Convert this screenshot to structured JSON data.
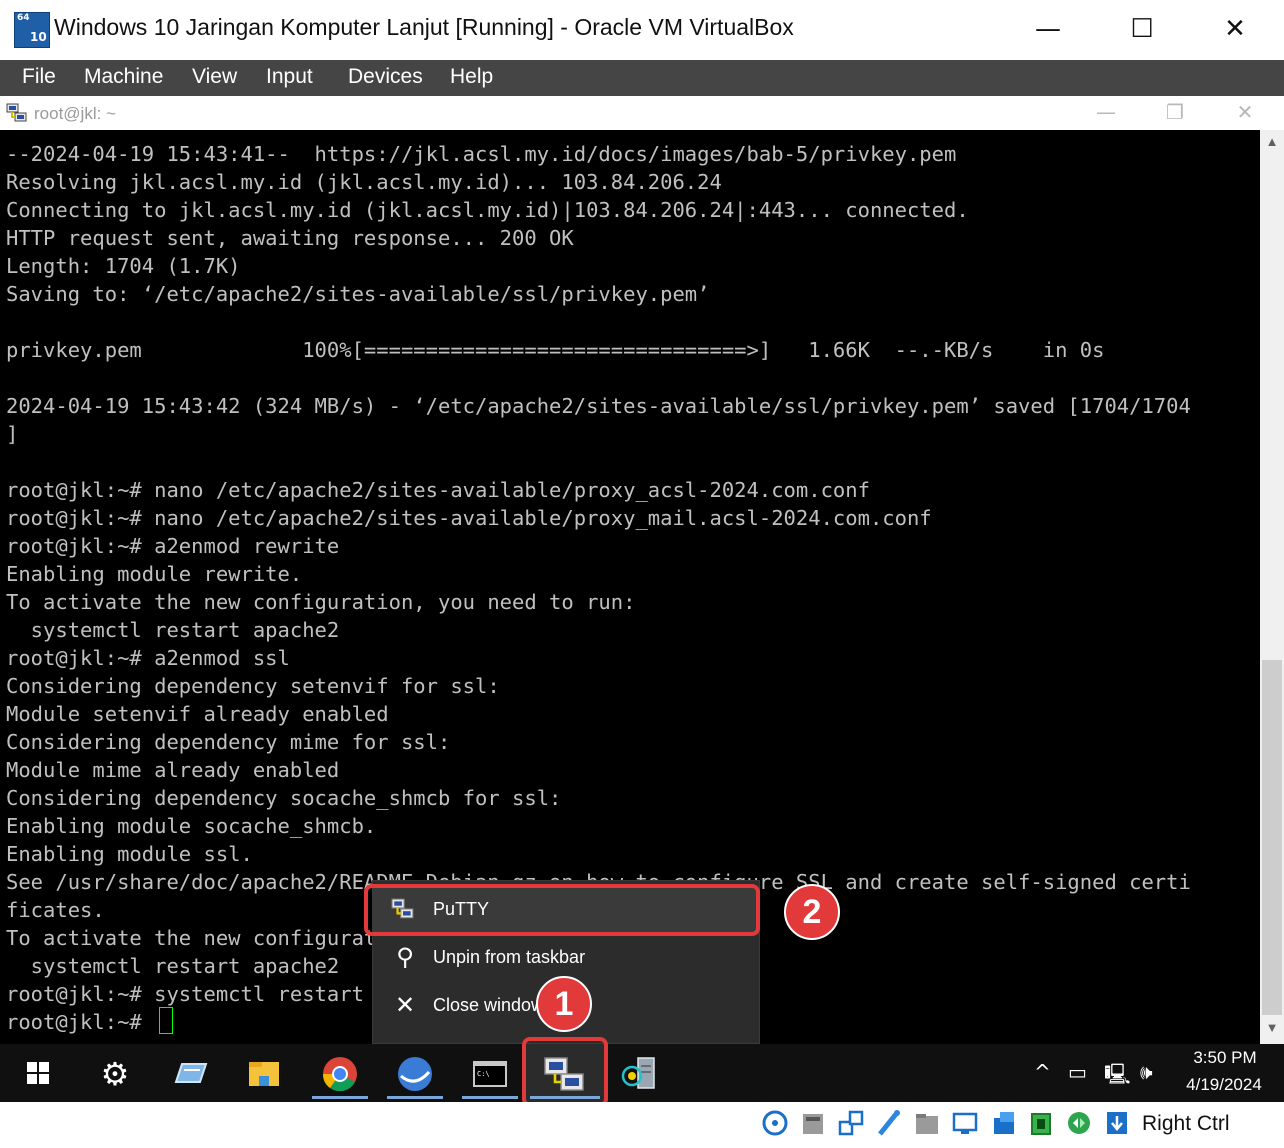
{
  "window": {
    "title": "Windows 10 Jaringan Komputer Lanjut [Running] - Oracle VM VirtualBox",
    "logo_text": "64",
    "logo_sub": "10",
    "minimize_glyph": "—",
    "maximize_glyph": "☐",
    "close_glyph": "✕"
  },
  "menubar": {
    "items": [
      {
        "label": "File"
      },
      {
        "label": "Machine"
      },
      {
        "label": "View"
      },
      {
        "label": "Input"
      },
      {
        "label": "Devices"
      },
      {
        "label": "Help"
      }
    ]
  },
  "putty": {
    "title": "root@jkl: ~",
    "minimize_glyph": "—",
    "restore_glyph": "❐",
    "close_glyph": "✕"
  },
  "terminal": {
    "text": "--2024-04-19 15:43:41--  https://jkl.acsl.my.id/docs/images/bab-5/privkey.pem\nResolving jkl.acsl.my.id (jkl.acsl.my.id)... 103.84.206.24\nConnecting to jkl.acsl.my.id (jkl.acsl.my.id)|103.84.206.24|:443... connected.\nHTTP request sent, awaiting response... 200 OK\nLength: 1704 (1.7K)\nSaving to: ‘/etc/apache2/sites-available/ssl/privkey.pem’\n\nprivkey.pem             100%[===============================>]   1.66K  --.-KB/s    in 0s\n\n2024-04-19 15:43:42 (324 MB/s) - ‘/etc/apache2/sites-available/ssl/privkey.pem’ saved [1704/1704\n]\n\nroot@jkl:~# nano /etc/apache2/sites-available/proxy_acsl-2024.com.conf\nroot@jkl:~# nano /etc/apache2/sites-available/proxy_mail.acsl-2024.com.conf\nroot@jkl:~# a2enmod rewrite\nEnabling module rewrite.\nTo activate the new configuration, you need to run:\n  systemctl restart apache2\nroot@jkl:~# a2enmod ssl\nConsidering dependency setenvif for ssl:\nModule setenvif already enabled\nConsidering dependency mime for ssl:\nModule mime already enabled\nConsidering dependency socache_shmcb for ssl:\nEnabling module socache_shmcb.\nEnabling module ssl.\nSee /usr/share/doc/apache2/README.Debian.gz on how to configure SSL and create self-signed certi\nficates.\nTo activate the new configuration, you need to run:\n  systemctl restart apache2\nroot@jkl:~# systemctl restart apache2\nroot@jkl:~# "
  },
  "context_menu": {
    "items": [
      {
        "label": "PuTTY",
        "icon": "putty-icon"
      },
      {
        "label": "Unpin from taskbar",
        "icon": "unpin-icon"
      },
      {
        "label": "Close window",
        "icon": "close-icon"
      }
    ]
  },
  "annotations": {
    "badge_1": "1",
    "badge_2": "2",
    "highlight_color": "#e23a3a"
  },
  "taskbar": {
    "apps": [
      {
        "name": "start-icon"
      },
      {
        "name": "settings-gear-icon"
      },
      {
        "name": "network-adapter-icon"
      },
      {
        "name": "file-explorer-icon"
      },
      {
        "name": "chrome-icon"
      },
      {
        "name": "wireshark-icon"
      },
      {
        "name": "command-prompt-icon"
      },
      {
        "name": "putty-icon"
      },
      {
        "name": "server-app-icon"
      }
    ],
    "tray": {
      "chevron": "^",
      "time": "3:50 PM",
      "date": "4/19/2024"
    }
  },
  "statusbar": {
    "host_key": "Right Ctrl"
  }
}
